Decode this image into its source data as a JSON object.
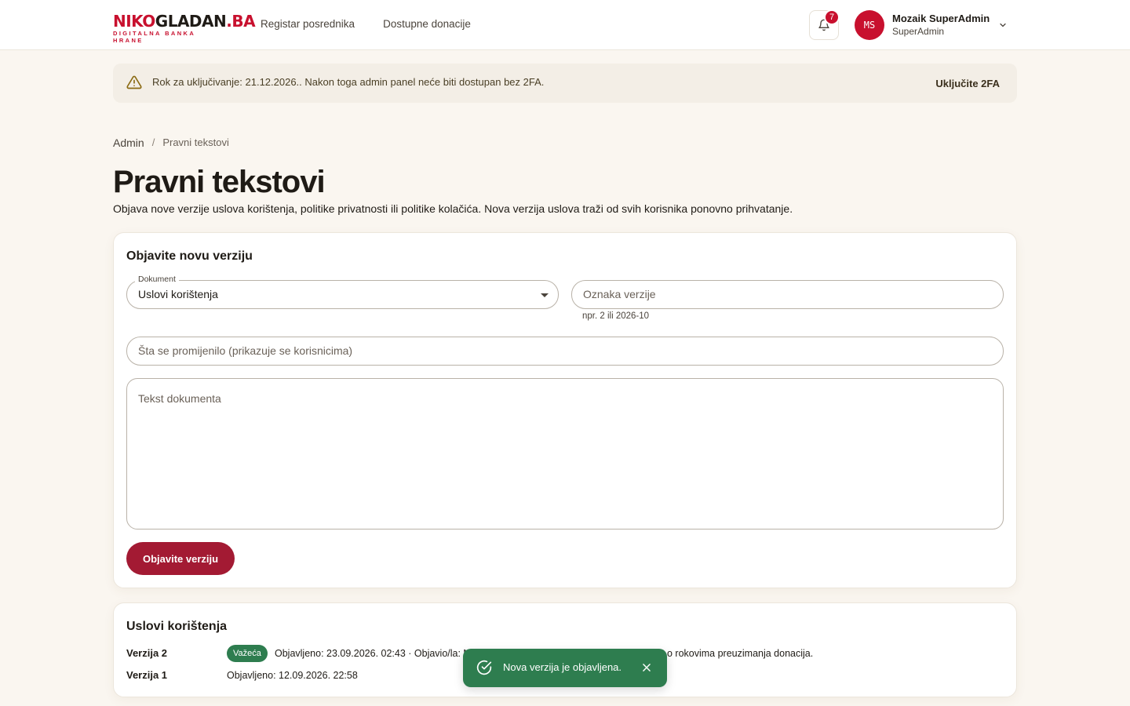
{
  "header": {
    "logo_part1": "NIKO",
    "logo_part2": "GLADAN",
    "logo_part3": ".BA",
    "logo_sub": "DIGITALNA BANKA HRANE",
    "nav": [
      "Registar posrednika",
      "Dostupne donacije"
    ],
    "notification_count": "7",
    "user_initials": "MS",
    "user_name": "Mozaik SuperAdmin",
    "user_role": "SuperAdmin"
  },
  "alert": {
    "text": "Rok za uključivanje: 21.12.2026.. Nakon toga admin panel neće biti dostupan bez 2FA.",
    "action": "Uključite 2FA"
  },
  "breadcrumb": {
    "root": "Admin",
    "separator": "/",
    "current": "Pravni tekstovi"
  },
  "page": {
    "title": "Pravni tekstovi",
    "description": "Objava nove verzije uslova korištenja, politike privatnosti ili politike kolačića. Nova verzija uslova traži od svih korisnika ponovno prihvatanje."
  },
  "publish_form": {
    "title": "Objavite novu verziju",
    "document_label": "Dokument",
    "document_value": "Uslovi korištenja",
    "version_placeholder": "Oznaka verzije",
    "version_helper": "npr. 2 ili 2026-10",
    "changes_placeholder": "Šta se promijenilo (prikazuje se korisnicima)",
    "body_placeholder": "Tekst dokumenta",
    "submit": "Objavite verziju"
  },
  "versions_card": {
    "title": "Uslovi korištenja",
    "versions": [
      {
        "label": "Verzija 2",
        "badge": "Važeća",
        "meta": "Objavljeno: 23.09.2026. 02:43 · Objavio/la: M",
        "meta_tail": "o rokovima preuzimanja donacija."
      },
      {
        "label": "Verzija 1",
        "meta": "Objavljeno: 12.09.2026. 22:58"
      }
    ]
  },
  "toast": {
    "text": "Nova verzija je objavljena."
  },
  "colors": {
    "brand_red": "#c8102e",
    "button": "#a31a33",
    "success": "#2e7d4f",
    "background": "#faf6f0"
  }
}
